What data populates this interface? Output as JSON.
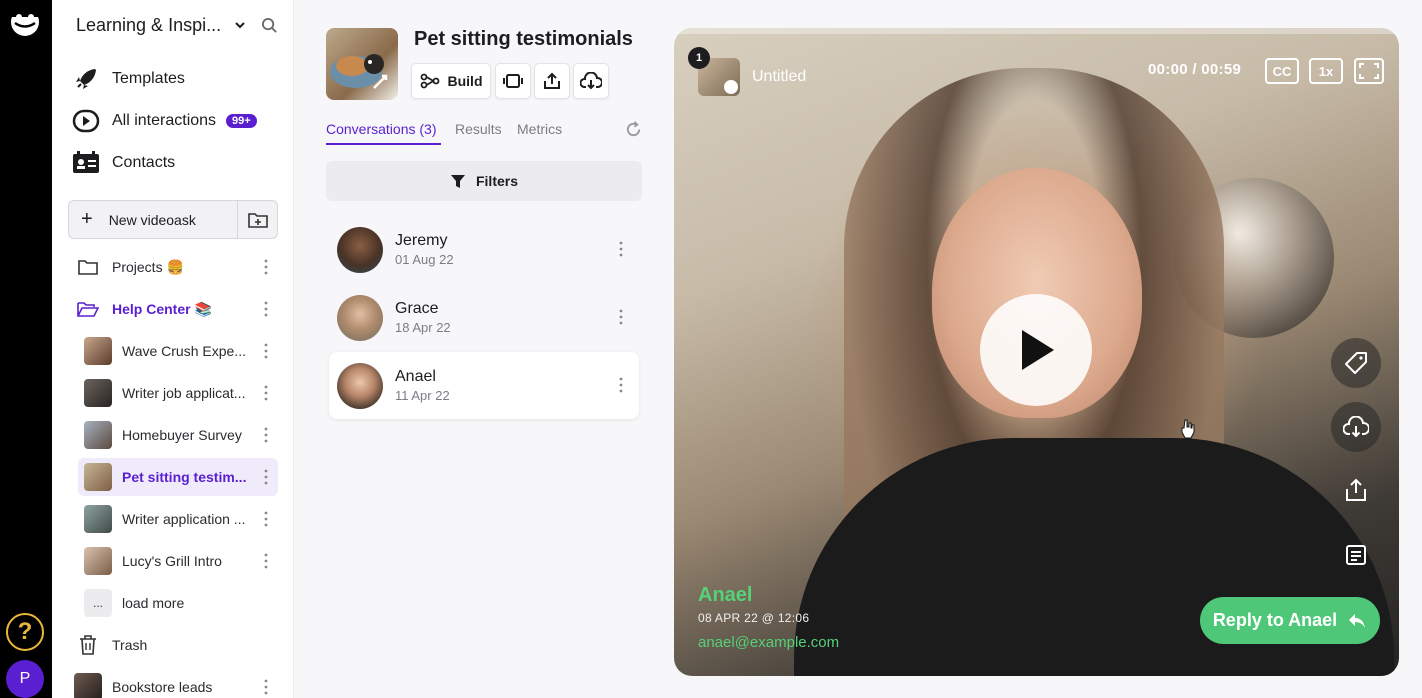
{
  "workspace": {
    "title": "Learning & Inspi..."
  },
  "nav": [
    {
      "label": "Templates",
      "icon": "rocket-icon"
    },
    {
      "label": "All interactions",
      "badge": "99+",
      "icon": "interactions-icon"
    },
    {
      "label": "Contacts",
      "icon": "contacts-icon"
    }
  ],
  "new_videoask": {
    "label": "New videoask"
  },
  "sidebar_items": [
    {
      "label": "Projects 🍔",
      "type": "folder"
    },
    {
      "label": "Help Center 📚",
      "type": "folder-open"
    },
    {
      "label": "Wave Crush Expe...",
      "type": "video"
    },
    {
      "label": "Writer job applicat...",
      "type": "video"
    },
    {
      "label": "Homebuyer Survey",
      "type": "video"
    },
    {
      "label": "Pet sitting testim...",
      "type": "video",
      "selected": true
    },
    {
      "label": "Writer application ...",
      "type": "video"
    },
    {
      "label": "Lucy's Grill Intro",
      "type": "video"
    },
    {
      "label": "load more",
      "thumb_text": "...",
      "type": "more"
    },
    {
      "label": "Trash",
      "type": "trash"
    },
    {
      "label": "Bookstore leads",
      "type": "video"
    }
  ],
  "rail": {
    "help": "?",
    "avatar": "P"
  },
  "videoask": {
    "title": "Pet sitting testimonials",
    "toolbar": {
      "build_label": "Build"
    },
    "tabs": [
      {
        "label": "Conversations (3)",
        "active": true
      },
      {
        "label": "Results"
      },
      {
        "label": "Metrics"
      }
    ],
    "filters_label": "Filters",
    "conversations": [
      {
        "name": "Jeremy",
        "date": "01 Aug 22"
      },
      {
        "name": "Grace",
        "date": "18 Apr 22"
      },
      {
        "name": "Anael",
        "date": "11 Apr 22",
        "active": true
      }
    ]
  },
  "player": {
    "step_number": "1",
    "step_title": "Untitled",
    "time": "00:00 / 00:59",
    "cc_label": "CC",
    "speed_label": "1x",
    "progress": 0,
    "respondent": {
      "name": "Anael",
      "date": "08 APR 22 @ 12:06",
      "email": "anael@example.com"
    },
    "reply_label": "Reply to Anael"
  },
  "colors": {
    "accent": "#5a1fd1",
    "reply_green": "#4fc779",
    "name_green": "#55d178",
    "help_yellow": "#e9b73a"
  }
}
